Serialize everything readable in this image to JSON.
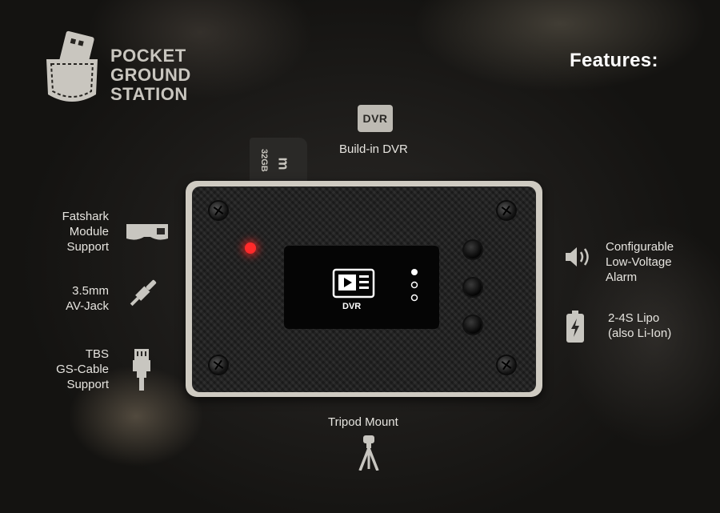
{
  "logo": {
    "line1": "POCKET",
    "line2": "GROUND",
    "line3": "STATION",
    "icon": "pocket-logo-icon"
  },
  "header": {
    "title": "Features:"
  },
  "features": {
    "dvr": {
      "badge": "DVR",
      "label": "Build-in DVR"
    },
    "fatshark": {
      "line1": "Fatshark",
      "line2": "Module",
      "line3": "Support",
      "icon": "goggles-icon"
    },
    "avjack": {
      "line1": "3.5mm",
      "line2": "AV-Jack",
      "icon": "audio-jack-icon"
    },
    "tbs": {
      "line1": "TBS",
      "line2": "GS-Cable",
      "line3": "Support",
      "icon": "connector-cable-icon"
    },
    "alarm": {
      "line1": "Configurable",
      "line2": "Low-Voltage",
      "line3": "Alarm",
      "icon": "speaker-icon"
    },
    "lipo": {
      "line1": "2-4S Lipo",
      "line2": "(also Li-Ion)",
      "icon": "battery-icon"
    },
    "tripod": {
      "label": "Tripod Mount",
      "icon": "tripod-icon"
    }
  },
  "device": {
    "sdcard_label": "32GB",
    "screen_label": "DVR",
    "led_color": "#ff2a2a"
  },
  "colors": {
    "accent_text": "#e6e4df",
    "logo": "#c9c6bf"
  }
}
